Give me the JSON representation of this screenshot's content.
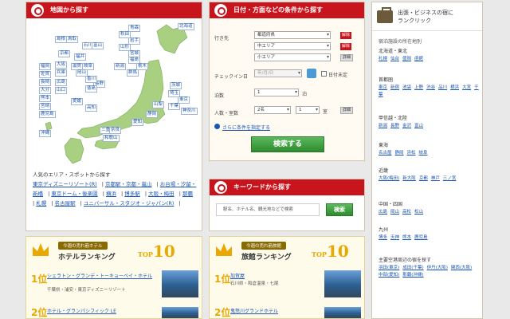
{
  "map_panel": {
    "title": "地図から探す",
    "prefectures": [
      {
        "id": "hokkaido",
        "label": "北海道"
      },
      {
        "id": "aomori",
        "label": "青森"
      },
      {
        "id": "akita",
        "label": "秋田"
      },
      {
        "id": "iwate",
        "label": "岩手"
      },
      {
        "id": "yamagata",
        "label": "山形"
      },
      {
        "id": "miyagi",
        "label": "宮城"
      },
      {
        "id": "fukushima",
        "label": "福島"
      },
      {
        "id": "niigata",
        "label": "新潟"
      },
      {
        "id": "ishikawa",
        "label": "石川"
      },
      {
        "id": "toyama",
        "label": "富山"
      },
      {
        "id": "tochigi",
        "label": "栃木"
      },
      {
        "id": "gunma",
        "label": "群馬"
      },
      {
        "id": "ibaraki",
        "label": "茨城"
      },
      {
        "id": "fukui",
        "label": "福井"
      },
      {
        "id": "nagano",
        "label": "長野"
      },
      {
        "id": "saitama",
        "label": "埼玉"
      },
      {
        "id": "tokyo",
        "label": "東京"
      },
      {
        "id": "chiba",
        "label": "千葉"
      },
      {
        "id": "kanagawa",
        "label": "神奈川"
      },
      {
        "id": "yamanashi",
        "label": "山梨"
      },
      {
        "id": "shizuoka",
        "label": "静岡"
      },
      {
        "id": "aichi",
        "label": "愛知"
      },
      {
        "id": "gifu",
        "label": "岐阜"
      },
      {
        "id": "shiga",
        "label": "滋賀"
      },
      {
        "id": "kyoto",
        "label": "京都"
      },
      {
        "id": "mie",
        "label": "三重"
      },
      {
        "id": "nara",
        "label": "奈良"
      },
      {
        "id": "osaka",
        "label": "大阪"
      },
      {
        "id": "hyogo",
        "label": "兵庫"
      },
      {
        "id": "wakayama",
        "label": "和歌山"
      },
      {
        "id": "tottori",
        "label": "鳥取"
      },
      {
        "id": "shimane",
        "label": "島根"
      },
      {
        "id": "okayama",
        "label": "岡山"
      },
      {
        "id": "hiroshima",
        "label": "広島"
      },
      {
        "id": "yamaguchi",
        "label": "山口"
      },
      {
        "id": "kagawa",
        "label": "香川"
      },
      {
        "id": "tokushima",
        "label": "徳島"
      },
      {
        "id": "ehime",
        "label": "愛媛"
      },
      {
        "id": "kochi",
        "label": "高知"
      },
      {
        "id": "fukuoka",
        "label": "福岡"
      },
      {
        "id": "saga",
        "label": "佐賀"
      },
      {
        "id": "nagasaki",
        "label": "長崎"
      },
      {
        "id": "oita",
        "label": "大分"
      },
      {
        "id": "kumamoto",
        "label": "熊本"
      },
      {
        "id": "miyazaki",
        "label": "宮崎"
      },
      {
        "id": "kagoshima",
        "label": "鹿児島"
      },
      {
        "id": "okinawa",
        "label": "沖縄"
      }
    ],
    "popular_title": "人気のエリア・スポットから探す",
    "popular_links": [
      "東京ディズニーリゾート(R)",
      "京都駅・京都・嵐山",
      "お台場・汐留・新橋",
      "東京ドーム・後楽園",
      "横浜",
      "博多駅",
      "大阪・梅田",
      "那覇",
      "札幌",
      "名古屋駅",
      "ユニバーサル・スタジオ・ジャパン(R)"
    ]
  },
  "cond_panel": {
    "title": "日付・方面などの条件から探す",
    "dest_label": "行き先",
    "dest_values": [
      "都道府県",
      "中エリア",
      "小エリア"
    ],
    "clear_label": "解除",
    "clear2_label": "解除",
    "detail_label": "詳細",
    "checkin_label": "チェックイン日",
    "checkin_value": "年/月/日",
    "undecided_label": "日付未定",
    "nights_label": "泊数",
    "nights_value": "1",
    "nights_unit": "泊",
    "rooms_label": "人数・室数",
    "rooms_value": "2名",
    "rooms_count": "1",
    "rooms_unit": "室",
    "rooms_detail": "詳細",
    "more_link": "さらに条件を指定する",
    "search_button": "検索する"
  },
  "kw_panel": {
    "title": "キーワードから探す",
    "placeholder": "駅名、ホテル名、観光地などで検索",
    "search_button": "検索"
  },
  "rank_panel": {
    "title_line1": "出張・ビジネスの宿に",
    "title_line2": "ランクリック",
    "intro": "宿泊施設の所在地別",
    "sections": [
      {
        "title": "北海道・東北",
        "links": [
          "札幌",
          "仙台",
          "盛岡",
          "函館"
        ]
      },
      {
        "title": "首都圏",
        "links": [
          "東京",
          "新宿",
          "池袋",
          "上野",
          "渋谷",
          "品川",
          "横浜",
          "大宮",
          "千葉"
        ]
      },
      {
        "title": "甲信越・北陸",
        "links": [
          "新潟",
          "長野",
          "金沢",
          "富山"
        ]
      },
      {
        "title": "東海",
        "links": [
          "名古屋",
          "静岡",
          "浜松",
          "岐阜"
        ]
      },
      {
        "title": "近畿",
        "links": [
          "大阪(梅田)",
          "新大阪",
          "京都",
          "神戸",
          "三ノ宮"
        ]
      },
      {
        "title": "中国・四国",
        "links": [
          "広島",
          "岡山",
          "高松",
          "松山"
        ]
      },
      {
        "title": "九州",
        "links": [
          "博多",
          "天神",
          "熊本",
          "鹿児島"
        ]
      },
      {
        "title": "主要空港周辺の宿を探す",
        "links": [
          "羽田(東京)",
          "成田(千葉)",
          "伊丹(大阪)",
          "関西(大阪)",
          "中部(愛知)",
          "那覇(沖縄)"
        ]
      }
    ]
  },
  "hotel_rank": {
    "subtitle": "今週の売れ筋ホテル",
    "title": "ホテルランキング",
    "top_label": "TOP",
    "top_num": "10",
    "items": [
      {
        "rank": "1位",
        "name": "シェラトン・グランデ・トーキョーベイ・ホテル",
        "desc": "千葉県・浦安・東京ディズニーリゾート"
      },
      {
        "rank": "2位",
        "name": "ホテル・グランパシフィック LE",
        "desc": ""
      }
    ]
  },
  "ryokan_rank": {
    "subtitle": "今週の売れ筋旅館",
    "title": "旅館ランキング",
    "top_label": "TOP",
    "top_num": "10",
    "items": [
      {
        "rank": "1位",
        "name": "加賀屋",
        "desc": "石川県・和倉温泉・七尾"
      },
      {
        "rank": "2位",
        "name": "鬼怒川グランドホテル",
        "desc": ""
      }
    ]
  },
  "colors": {
    "brand_red": "#c8141c",
    "link_blue": "#1a55b3",
    "map_green": "#a8d080",
    "gold": "#e8a800"
  }
}
